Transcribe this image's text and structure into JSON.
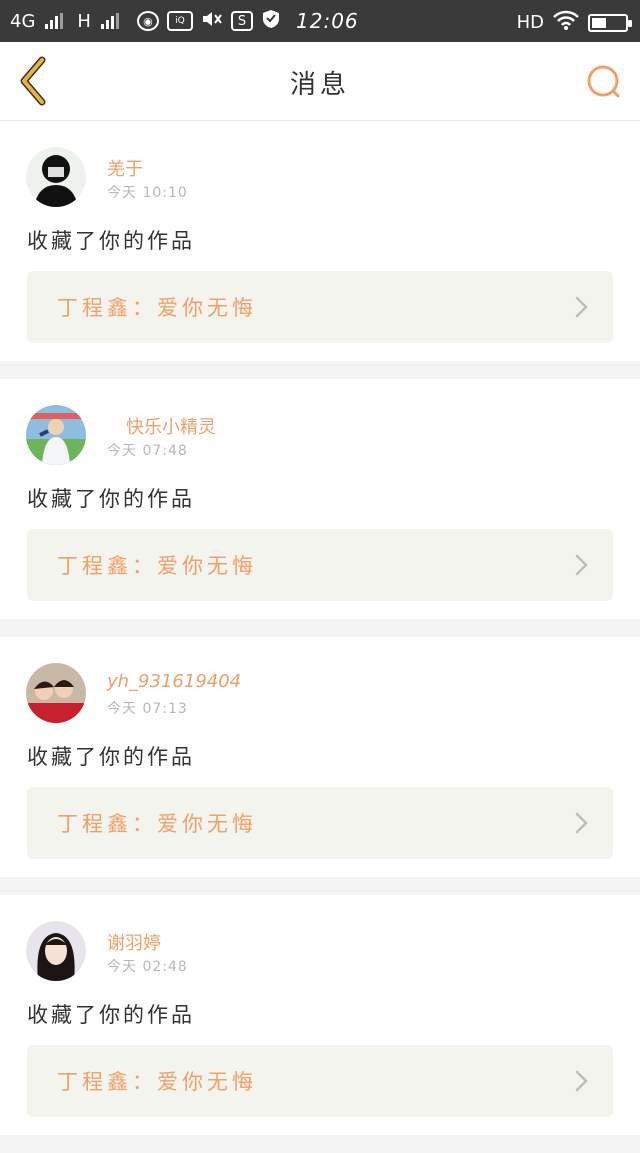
{
  "status_bar": {
    "network1": "4G",
    "network2": "H",
    "time": "12:06",
    "hd": "HD",
    "battery_level": 0.45,
    "icons": [
      "signal-icon",
      "signal-icon",
      "location-icon",
      "qiyi-icon",
      "volume-mute-icon",
      "s-app-icon",
      "shield-icon",
      "wifi-icon",
      "battery-icon"
    ]
  },
  "header": {
    "title": "消息",
    "back_icon": "chevron-left-icon",
    "search_icon": "search-icon"
  },
  "colors": {
    "accent": "#f0a06a",
    "back_icon": "#e7b33d",
    "card_bg": "#ffffff",
    "work_bg": "#f4f4ee",
    "page_bg": "#f3f3f3"
  },
  "messages": [
    {
      "username": "羌于",
      "time": "今天  10:10",
      "action": "收藏了你的作品",
      "work_title": "丁程鑫：爱你无悔"
    },
    {
      "username": "快乐小精灵",
      "time": "今天  07:48",
      "action": "收藏了你的作品",
      "work_title": "丁程鑫：爱你无悔"
    },
    {
      "username": "yh_931619404",
      "time": "今天  07:13",
      "action": "收藏了你的作品",
      "work_title": "丁程鑫：爱你无悔"
    },
    {
      "username": "谢羽婷",
      "time": "今天  02:48",
      "action": "收藏了你的作品",
      "work_title": "丁程鑫：爱你无悔"
    }
  ]
}
